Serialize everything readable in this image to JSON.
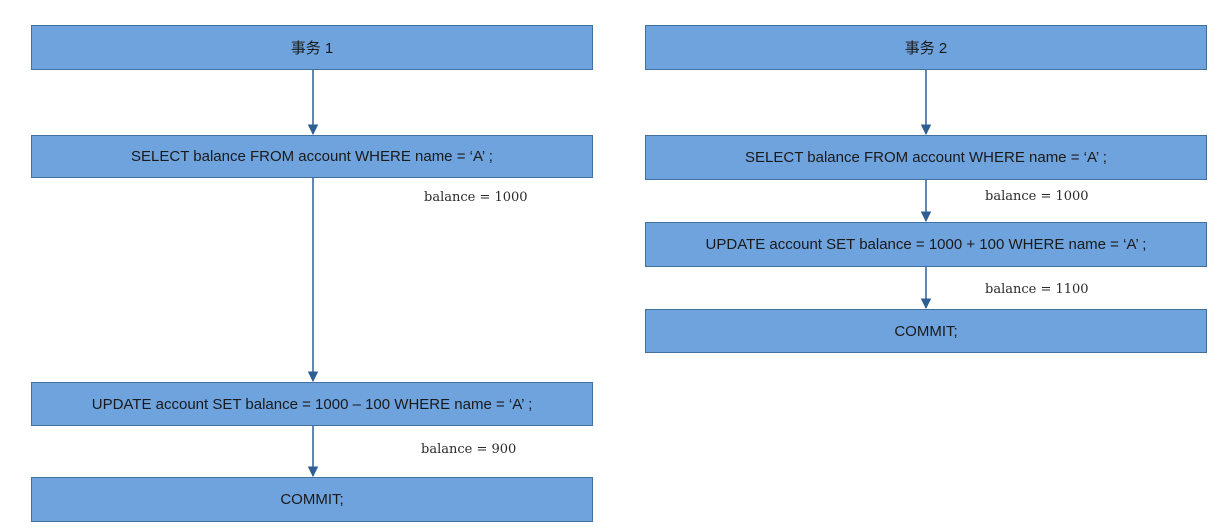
{
  "colors": {
    "box_fill": "#6fa3dd",
    "box_border": "#41719c",
    "arrow": "#2f5f92"
  },
  "transaction_1": {
    "title": "事务 1",
    "step_1": "SELECT balance FROM account WHERE name =  ‘A’ ;",
    "note_1": "balance = 1000",
    "step_2": "UPDATE account SET balance = 1000 – 100 WHERE name =  ‘A’ ;",
    "note_2": "balance = 900",
    "step_3": "COMMIT;"
  },
  "transaction_2": {
    "title": "事务 2",
    "step_1": "SELECT balance FROM account WHERE name =  ‘A’ ;",
    "note_1": "balance = 1000",
    "step_2": "UPDATE account SET balance = 1000 + 100 WHERE name =  ‘A’ ;",
    "note_2": "balance = 1100",
    "step_3": "COMMIT;"
  }
}
